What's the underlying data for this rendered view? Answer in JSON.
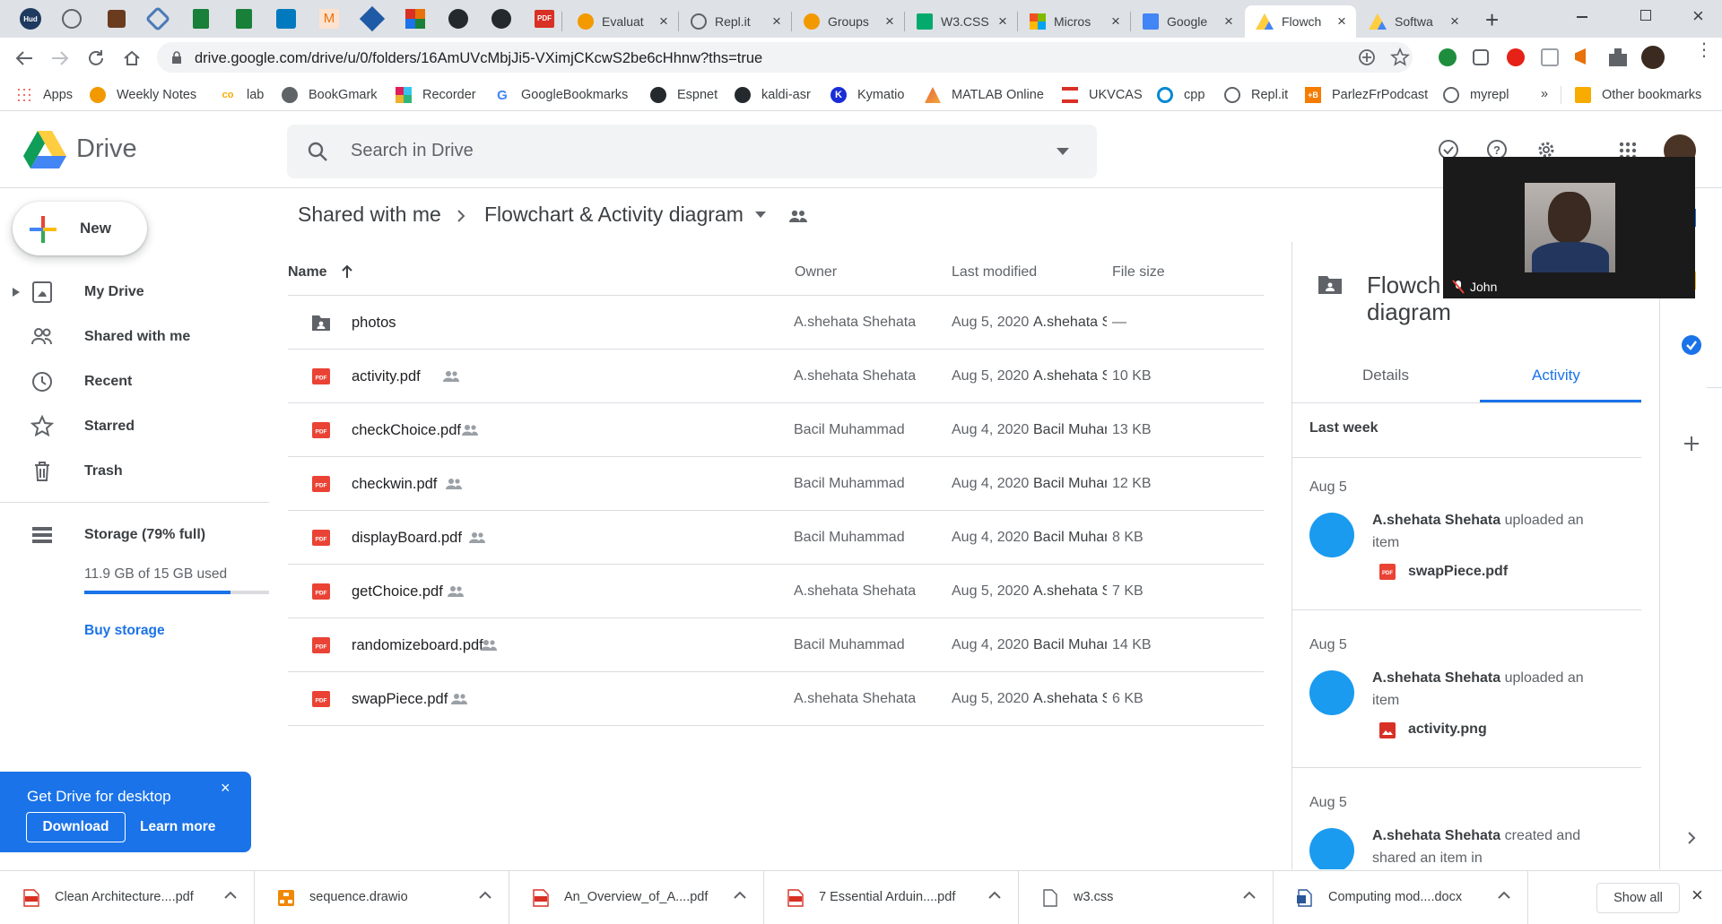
{
  "browser": {
    "tabs": [
      {
        "title": "Evaluat",
        "fav_color": "#f29900",
        "fav_icon": "circle-b-icon"
      },
      {
        "title": "Repl.it",
        "fav_color": "#5f6368",
        "fav_icon": "replit-icon"
      },
      {
        "title": "Groups",
        "fav_color": "#f29900",
        "fav_icon": "circle-b-icon"
      },
      {
        "title": "W3.CSS",
        "fav_color": "#04aa6d",
        "fav_icon": "w3-icon"
      },
      {
        "title": "Micros",
        "fav_color": "#f25022",
        "fav_icon": "microsoft-icon"
      },
      {
        "title": "Google",
        "fav_color": "#4285f4",
        "fav_icon": "docs-icon"
      },
      {
        "title": "Flowch",
        "fav_color": "#188038",
        "fav_icon": "drive-icon",
        "active": true
      },
      {
        "title": "Softwa",
        "fav_color": "#188038",
        "fav_icon": "drive-icon"
      }
    ],
    "url": "drive.google.com/drive/u/0/folders/16AmUVcMbjJi5-VXimjCKcwS2be6cHhnw?ths=true"
  },
  "bookmarks": [
    {
      "label": "Apps",
      "icon": "apps-grid-icon"
    },
    {
      "label": "Weekly Notes",
      "icon": "circle-b-icon"
    },
    {
      "label": "lab",
      "icon": "co-icon"
    },
    {
      "label": "BookGmark",
      "icon": "globe-icon"
    },
    {
      "label": "Recorder",
      "icon": "slack-icon"
    },
    {
      "label": "GoogleBookmarks",
      "icon": "google-g-icon"
    },
    {
      "label": "Espnet",
      "icon": "github-icon"
    },
    {
      "label": "kaldi-asr",
      "icon": "github-icon"
    },
    {
      "label": "Kymatio",
      "icon": "k-icon"
    },
    {
      "label": "MATLAB Online",
      "icon": "matlab-icon"
    },
    {
      "label": "UKVCAS",
      "icon": "ukvcas-icon"
    },
    {
      "label": "cpp",
      "icon": "cpp-icon"
    },
    {
      "label": "Repl.it",
      "icon": "replit-icon"
    },
    {
      "label": "ParlezFrPodcast",
      "icon": "b-square-icon"
    },
    {
      "label": "myrepl",
      "icon": "replit-icon"
    }
  ],
  "bookmarks_more": "»",
  "other_bookmarks": "Other bookmarks",
  "drive": {
    "app_name": "Drive",
    "search_placeholder": "Search in Drive",
    "new_label": "New",
    "nav": [
      {
        "label": "My Drive",
        "icon": "my-drive-icon"
      },
      {
        "label": "Shared with me",
        "icon": "shared-icon"
      },
      {
        "label": "Recent",
        "icon": "clock-icon"
      },
      {
        "label": "Starred",
        "icon": "star-icon"
      },
      {
        "label": "Trash",
        "icon": "trash-icon"
      }
    ],
    "storage_label": "Storage (79% full)",
    "storage_used": "11.9 GB of 15 GB used",
    "storage_fraction": 0.79,
    "buy_storage": "Buy storage",
    "breadcrumb": {
      "parent": "Shared with me",
      "separator": ">",
      "current": "Flowchart & Activity diagram"
    },
    "columns": {
      "name": "Name",
      "owner": "Owner",
      "modified": "Last modified",
      "size": "File size"
    },
    "files": [
      {
        "name": "photos",
        "type": "folder",
        "shared": false,
        "owner": "A.shehata Shehata",
        "date": "Aug 5, 2020",
        "by": "A.shehata Shehata",
        "size": "—"
      },
      {
        "name": "activity.pdf",
        "type": "pdf",
        "shared": true,
        "owner": "A.shehata Shehata",
        "date": "Aug 5, 2020",
        "by": "A.shehata Shehata",
        "size": "10 KB"
      },
      {
        "name": "checkChoice.pdf",
        "type": "pdf",
        "shared": true,
        "owner": "Bacil Muhammad",
        "date": "Aug 4, 2020",
        "by": "Bacil Muhammad",
        "size": "13 KB"
      },
      {
        "name": "checkwin.pdf",
        "type": "pdf",
        "shared": true,
        "owner": "Bacil Muhammad",
        "date": "Aug 4, 2020",
        "by": "Bacil Muhammad",
        "size": "12 KB"
      },
      {
        "name": "displayBoard.pdf",
        "type": "pdf",
        "shared": true,
        "owner": "Bacil Muhammad",
        "date": "Aug 4, 2020",
        "by": "Bacil Muhammad",
        "size": "8 KB"
      },
      {
        "name": "getChoice.pdf",
        "type": "pdf",
        "shared": true,
        "owner": "A.shehata Shehata",
        "date": "Aug 5, 2020",
        "by": "A.shehata Shehata",
        "size": "7 KB"
      },
      {
        "name": "randomizeboard.pdf",
        "type": "pdf",
        "shared": true,
        "owner": "Bacil Muhammad",
        "date": "Aug 4, 2020",
        "by": "Bacil Muhammad",
        "size": "14 KB"
      },
      {
        "name": "swapPiece.pdf",
        "type": "pdf",
        "shared": true,
        "owner": "A.shehata Shehata",
        "date": "Aug 5, 2020",
        "by": "A.shehata Shehata",
        "size": "6 KB"
      }
    ],
    "details": {
      "title_line1": "Flowch",
      "title_line2": "diagram",
      "tab_details": "Details",
      "tab_activity": "Activity",
      "section": "Last week",
      "activity": [
        {
          "date": "Aug 5",
          "actor": "A.shehata Shehata",
          "action": "uploaded an item",
          "file": "swapPiece.pdf",
          "file_type": "pdf"
        },
        {
          "date": "Aug 5",
          "actor": "A.shehata Shehata",
          "action": "uploaded an item",
          "file": "activity.png",
          "file_type": "image"
        },
        {
          "date": "Aug 5",
          "actor": "A.shehata Shehata",
          "action": "created and shared an item in",
          "file": "",
          "file_type": ""
        }
      ]
    },
    "promo": {
      "title": "Get Drive for desktop",
      "download": "Download",
      "learn_more": "Learn more",
      "close": "×"
    }
  },
  "video_overlay": {
    "participant": "John"
  },
  "downloads": [
    {
      "name": "Clean Architecture....pdf",
      "icon": "pdf-icon"
    },
    {
      "name": "sequence.drawio",
      "icon": "drawio-icon"
    },
    {
      "name": "An_Overview_of_A....pdf",
      "icon": "pdf-icon"
    },
    {
      "name": "7 Essential Arduin....pdf",
      "icon": "pdf-icon"
    },
    {
      "name": "w3.css",
      "icon": "file-icon"
    },
    {
      "name": "Computing mod....docx",
      "icon": "word-icon"
    }
  ],
  "show_all": "Show all",
  "colors": {
    "accent": "#1a73e8",
    "pdf_red": "#ea4335",
    "activity_dot": "#1a9bf0"
  }
}
